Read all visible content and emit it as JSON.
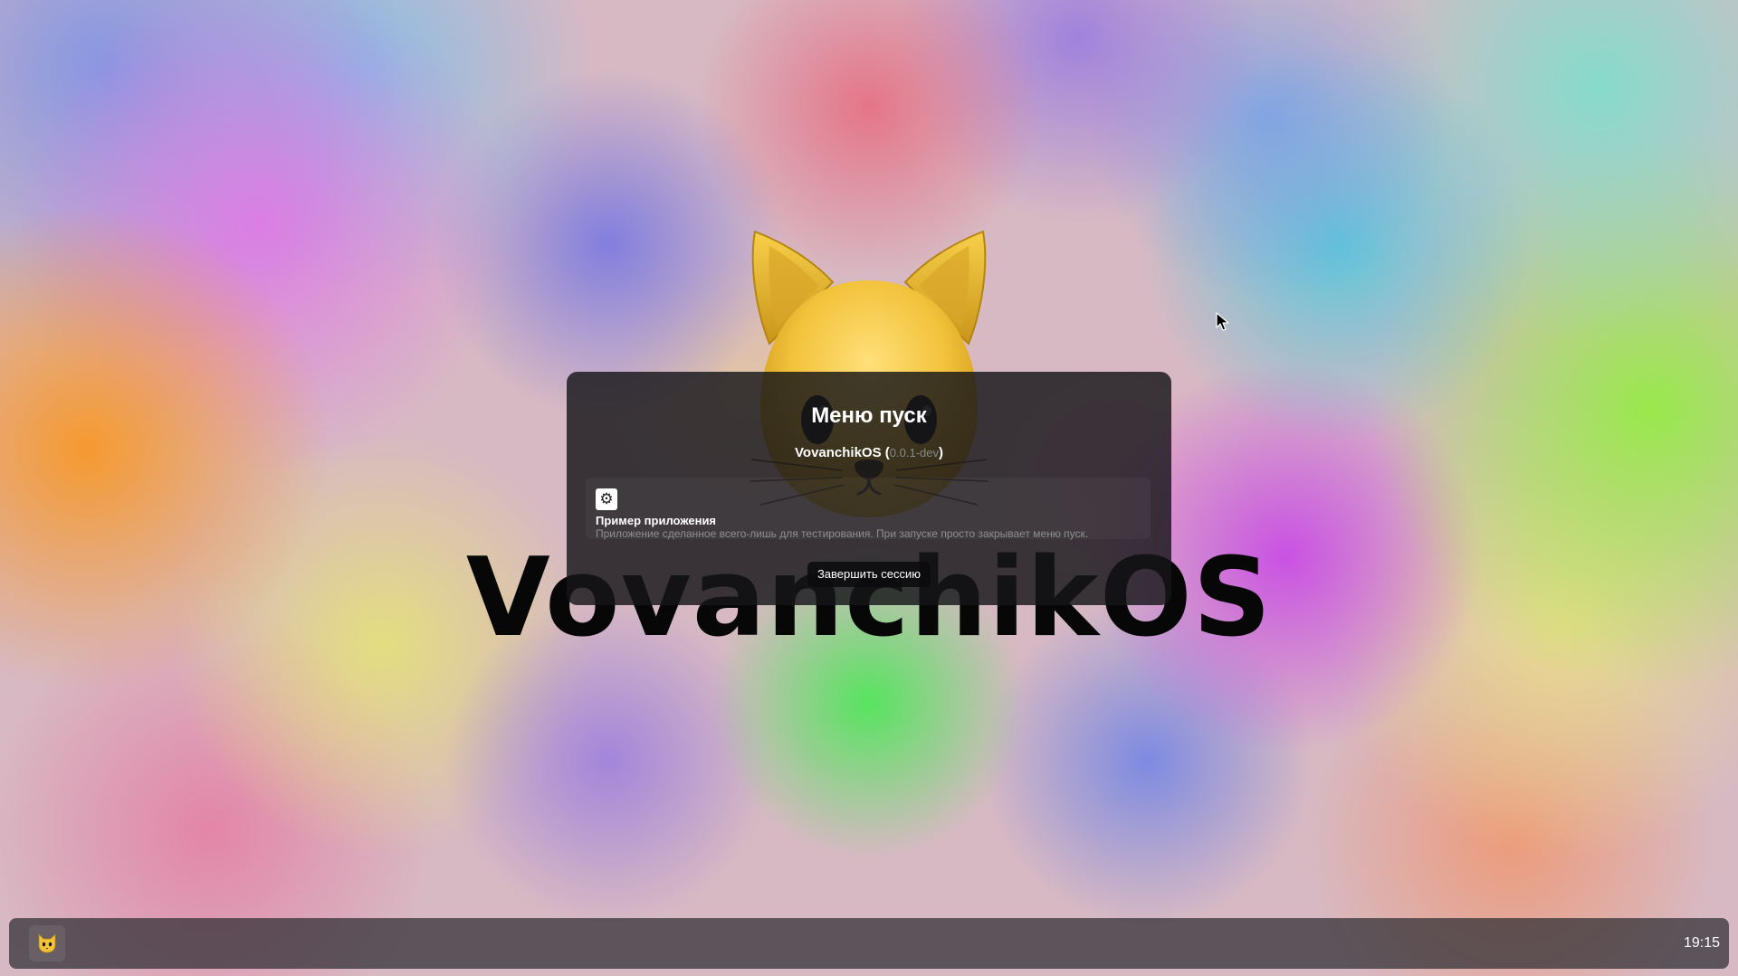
{
  "wallpaper": {
    "title": "VovanchikOS"
  },
  "start_menu": {
    "title": "Меню пуск",
    "os_name": "VovanchikOS",
    "version_open": " (",
    "version": "0.0.1-dev",
    "version_close": ")",
    "apps": [
      {
        "icon": "gear-icon",
        "name": "Пример приложения",
        "description": "Приложение сделанное всего-лишь для тестирования. При запуске просто закрывает меню пуск."
      }
    ],
    "logout_label": "Завершить сессию"
  },
  "taskbar": {
    "start_icon": "cat-face-icon",
    "clock": "19:15"
  },
  "colors": {
    "menu_background": "#16161a",
    "taskbar_background": "#2d2d32",
    "cat_yellow": "#f2c23a",
    "wallpaper_text": "#070707"
  }
}
